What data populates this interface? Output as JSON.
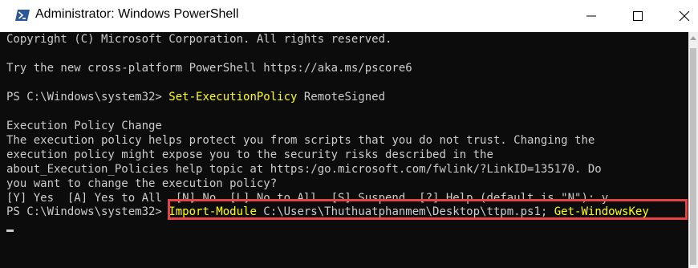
{
  "window": {
    "title": "Administrator: Windows PowerShell",
    "icon": "powershell-icon",
    "controls": {
      "minimize": "minimize-icon",
      "maximize": "maximize-icon",
      "close": "close-icon"
    }
  },
  "console": {
    "colors": {
      "background": "#0c0c0c",
      "text": "#cccccc",
      "command": "#ffff00",
      "highlight_box": "#e64343"
    },
    "lines": {
      "copyright": "Copyright (C) Microsoft Corporation. All rights reserved.",
      "try_new": "Try the new cross-platform PowerShell https://aka.ms/pscore6",
      "prompt1": "PS C:\\Windows\\system32> ",
      "cmd1_name": "Set-ExecutionPolicy",
      "cmd1_arg": " RemoteSigned",
      "policy_heading": "Execution Policy Change",
      "policy_line1": "The execution policy helps protect you from scripts that you do not trust. Changing the",
      "policy_line2": "execution policy might expose you to the security risks described in the",
      "policy_line3": "about_Execution_Policies help topic at https:/go.microsoft.com/fwlink/?LinkID=135170. Do",
      "policy_question": "you want to change the execution policy?",
      "choices": "[Y] Yes  [A] Yes to All  [N] No  [L] No to All  [S] Suspend  [?] Help (default is \"N\"): y",
      "prompt2": "PS C:\\Windows\\system32> ",
      "cmd2_name": "Import-Module",
      "cmd2_arg": " C:\\Users\\Thuthuatphanmem\\Desktop\\ttpm.ps1",
      "cmd2_sep": "; ",
      "cmd3_name": "Get-WindowsKey"
    }
  }
}
